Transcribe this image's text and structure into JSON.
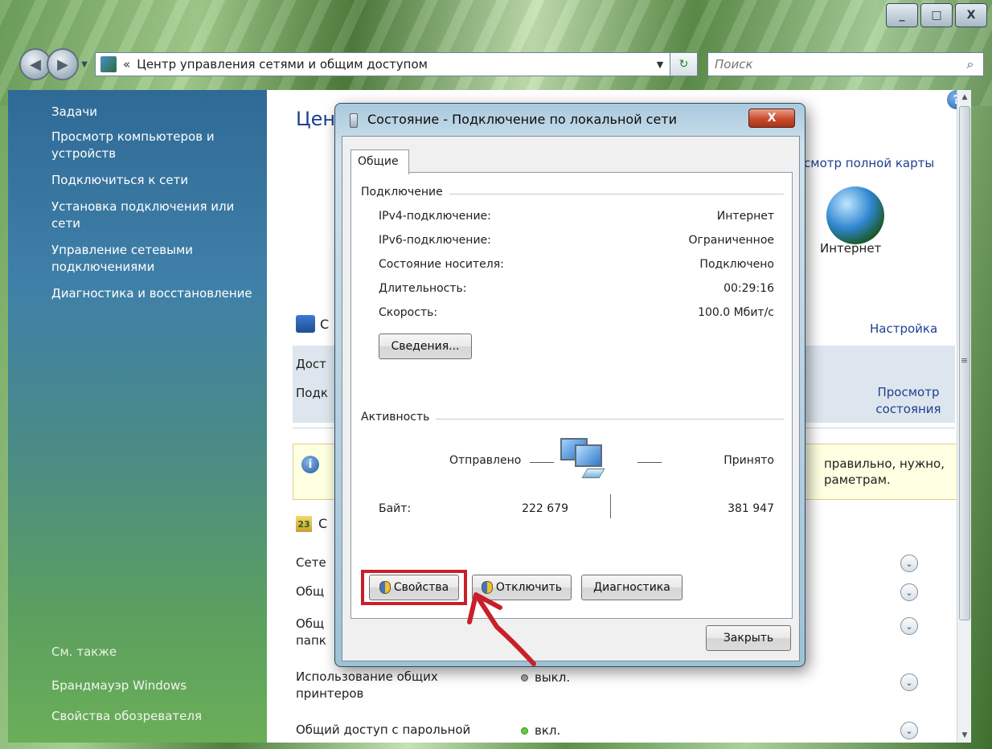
{
  "window": {
    "address": "Центр управления сетями и общим доступом",
    "address_prefix": "«",
    "search_placeholder": "Поиск",
    "caption_minimize": "_",
    "caption_maximize": "□",
    "caption_close": "X"
  },
  "sidebar": {
    "title": "Задачи",
    "items": [
      "Просмотр компьютеров и устройств",
      "Подключиться к сети",
      "Установка подключения или сети",
      "Управление сетевыми подключениями",
      "Диагностика и восстановление"
    ],
    "see_also_title": "См. также",
    "see_also": [
      "Брандмауэр Windows",
      "Свойства обозревателя"
    ]
  },
  "main": {
    "title_partial": "Цент",
    "full_map_link": "смотр полной карты",
    "internet_label": "Интернет",
    "network_section_partial": "С",
    "setup_link": "Настройка",
    "access_partial": "Дост",
    "connection_partial": "Подк",
    "view_status_link": "Просмотр состояния",
    "warning_text": "правильно, нужно, раметрам.",
    "warning_partial": "\\",
    "sharing_partial": "С",
    "sharing_rows": [
      {
        "label": "Сете",
        "value": ""
      },
      {
        "label": "Общ",
        "value": ""
      },
      {
        "label": "Общ папк",
        "value": ""
      },
      {
        "label": "Использование общих принтеров",
        "value": "выкл.",
        "state": "off"
      },
      {
        "label": "Общий доступ с парольной",
        "value": "вкл.",
        "state": "on"
      }
    ]
  },
  "dialog": {
    "title": "Состояние - Подключение по локальной сети",
    "close": "X",
    "tab": "Общие",
    "connection_group": "Подключение",
    "rows": [
      {
        "label": "IPv4-подключение:",
        "value": "Интернет"
      },
      {
        "label": "IPv6-подключение:",
        "value": "Ограниченное"
      },
      {
        "label": "Состояние носителя:",
        "value": "Подключено"
      },
      {
        "label": "Длительность:",
        "value": "00:29:16"
      },
      {
        "label": "Скорость:",
        "value": "100.0 Мбит/с"
      }
    ],
    "details_button": "Сведения...",
    "activity_group": "Активность",
    "sent_label": "Отправлено",
    "received_label": "Принято",
    "bytes_label": "Байт:",
    "bytes_sent": "222 679",
    "bytes_received": "381 947",
    "properties_button": "Свойства",
    "disable_button": "Отключить",
    "diagnose_button": "Диагностика",
    "close_button": "Закрыть"
  },
  "colors": {
    "link": "#1e3f8f",
    "highlight": "#c8202a",
    "sidebar_top": "#2f6a96",
    "sidebar_bottom": "#6aae58"
  },
  "icons": [
    "search-icon",
    "refresh-icon",
    "help-icon",
    "globe-icon",
    "network-icon",
    "info-icon",
    "shield-icon",
    "computer-icon",
    "expand-icon"
  ]
}
